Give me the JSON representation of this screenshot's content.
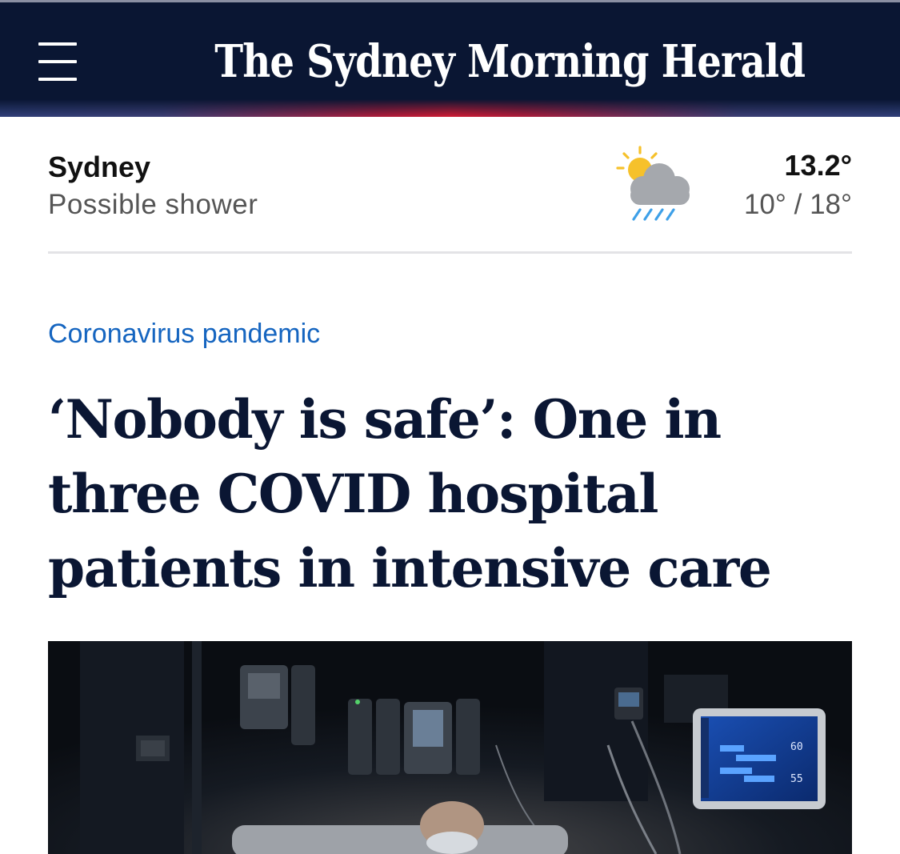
{
  "masthead": {
    "menu_icon": "hamburger-menu-icon",
    "logo_text": "The Sydney Morning Herald",
    "background": "#0a1633"
  },
  "weather": {
    "city": "Sydney",
    "description": "Possible shower",
    "icon": "partly-sunny-rain-icon",
    "current_temp": "13.2°",
    "range": "10° / 18°"
  },
  "article": {
    "kicker": "Coronavirus pandemic",
    "kicker_color": "#1565c0",
    "headline": "‘Nobody is safe’: One in three COVID hospital patients in intensive care",
    "headline_color": "#0a1633"
  },
  "hero_image": {
    "description_icon": "icu-photo",
    "monitor_readings": [
      "60",
      "55"
    ]
  }
}
